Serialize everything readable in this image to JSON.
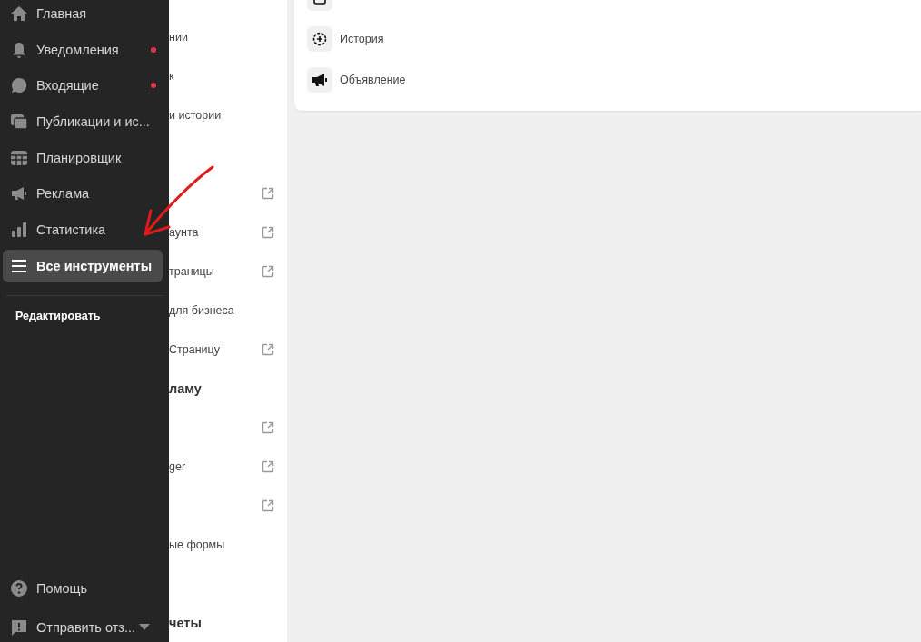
{
  "sidebar": {
    "items": [
      {
        "label": "Главная",
        "dot": false,
        "selected": false
      },
      {
        "label": "Уведомления",
        "dot": true,
        "selected": false
      },
      {
        "label": "Входящие",
        "dot": true,
        "selected": false
      },
      {
        "label": "Публикации и ис...",
        "dot": false,
        "selected": false
      },
      {
        "label": "Планировщик",
        "dot": false,
        "selected": false
      },
      {
        "label": "Реклама",
        "dot": false,
        "selected": false
      },
      {
        "label": "Статистика",
        "dot": false,
        "selected": false
      },
      {
        "label": "Все инструменты",
        "dot": false,
        "selected": true
      }
    ],
    "edit_link": "Редактировать",
    "footer": [
      {
        "label": "Помощь",
        "caret": false
      },
      {
        "label": "Отправить отз...",
        "caret": true
      }
    ]
  },
  "tools_list": [
    {
      "kind": "row",
      "text": "нии",
      "external": false
    },
    {
      "kind": "row",
      "text": "к",
      "external": false
    },
    {
      "kind": "row",
      "text": "и истории",
      "external": false
    },
    {
      "kind": "spacer"
    },
    {
      "kind": "row",
      "external": true
    },
    {
      "kind": "row",
      "text": "аунта",
      "external": true
    },
    {
      "kind": "row",
      "text": "траницы",
      "external": true
    },
    {
      "kind": "row",
      "text": "для бизнеса",
      "external": false
    },
    {
      "kind": "row",
      "text": "Страницу",
      "external": true
    },
    {
      "kind": "heading",
      "text": "ламу"
    },
    {
      "kind": "row",
      "external": true
    },
    {
      "kind": "row",
      "text": "ger",
      "external": true
    },
    {
      "kind": "row",
      "external": true
    },
    {
      "kind": "row",
      "text": "ые формы",
      "external": false
    },
    {
      "kind": "spacer"
    },
    {
      "kind": "heading",
      "text": "четы"
    }
  ],
  "create_card": {
    "items": [
      {
        "kind": "cut_off"
      },
      {
        "kind": "option",
        "label": "История"
      },
      {
        "kind": "option",
        "label": "Объявление"
      }
    ]
  }
}
